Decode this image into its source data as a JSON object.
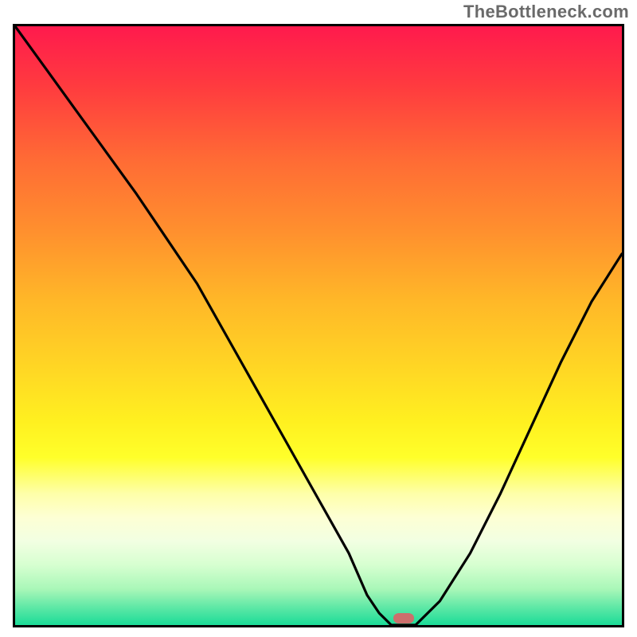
{
  "watermark": "TheBottleneck.com",
  "colors": {
    "gradient_top": "#ff1a4d",
    "gradient_bottom": "#1cdc98",
    "curve": "#000000",
    "marker": "#cc6f6c",
    "frame": "#000000"
  },
  "chart_data": {
    "type": "line",
    "title": "",
    "xlabel": "",
    "ylabel": "",
    "xlim": [
      0,
      100
    ],
    "ylim": [
      0,
      100
    ],
    "grid": false,
    "legend": false,
    "annotation": "TheBottleneck.com",
    "background_gradient": {
      "top_color": "#ff1a4d",
      "bottom_color": "#1cdc98",
      "meaning": "red (high bottleneck) to green (low bottleneck)"
    },
    "marker_x": 64,
    "series": [
      {
        "name": "bottleneck-curve",
        "x": [
          0,
          5,
          10,
          15,
          20,
          24,
          30,
          35,
          40,
          45,
          50,
          55,
          58,
          60,
          62,
          64,
          66,
          70,
          75,
          80,
          85,
          90,
          95,
          100
        ],
        "y": [
          100,
          93,
          86,
          79,
          72,
          66,
          57,
          48,
          39,
          30,
          21,
          12,
          5,
          2,
          0,
          0,
          0,
          4,
          12,
          22,
          33,
          44,
          54,
          62
        ]
      }
    ]
  }
}
